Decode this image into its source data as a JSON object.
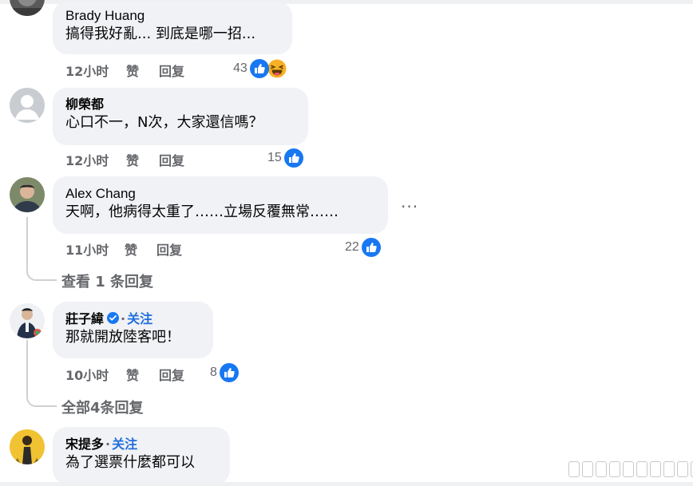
{
  "comments": [
    {
      "author": "Brady Huang",
      "text": "搞得我好亂... 到底是哪一招...",
      "time": "12小时",
      "like_label": "赞",
      "reply_label": "回复",
      "reaction_count": "43",
      "reactions": [
        "like-icon",
        "haha-icon"
      ]
    },
    {
      "author": "柳榮都",
      "text": "心口不一，N次，大家還信嗎？",
      "time": "12小时",
      "like_label": "赞",
      "reply_label": "回复",
      "reaction_count": "15",
      "reactions": [
        "like-icon"
      ]
    },
    {
      "author": "Alex Chang",
      "text": "天啊，他病得太重了……立場反覆無常……",
      "time": "11小时",
      "like_label": "赞",
      "reply_label": "回复",
      "reaction_count": "22",
      "reactions": [
        "like-icon"
      ],
      "more_label": "···",
      "view_replies": "查看 1 条回复"
    },
    {
      "author": "莊子緯",
      "verified": true,
      "follow_label": "关注",
      "text": "那就開放陸客吧！",
      "time": "10小时",
      "like_label": "赞",
      "reply_label": "回复",
      "reaction_count": "8",
      "reactions": [
        "like-icon"
      ],
      "view_replies": "全部4条回复"
    },
    {
      "author": "宋提多",
      "follow_label": "关注",
      "text": "為了選票什麼都可以"
    }
  ],
  "colors": {
    "bubble": "#f0f2f5",
    "meta": "#65676b",
    "link": "#216fdb",
    "like": "#1877f2"
  }
}
